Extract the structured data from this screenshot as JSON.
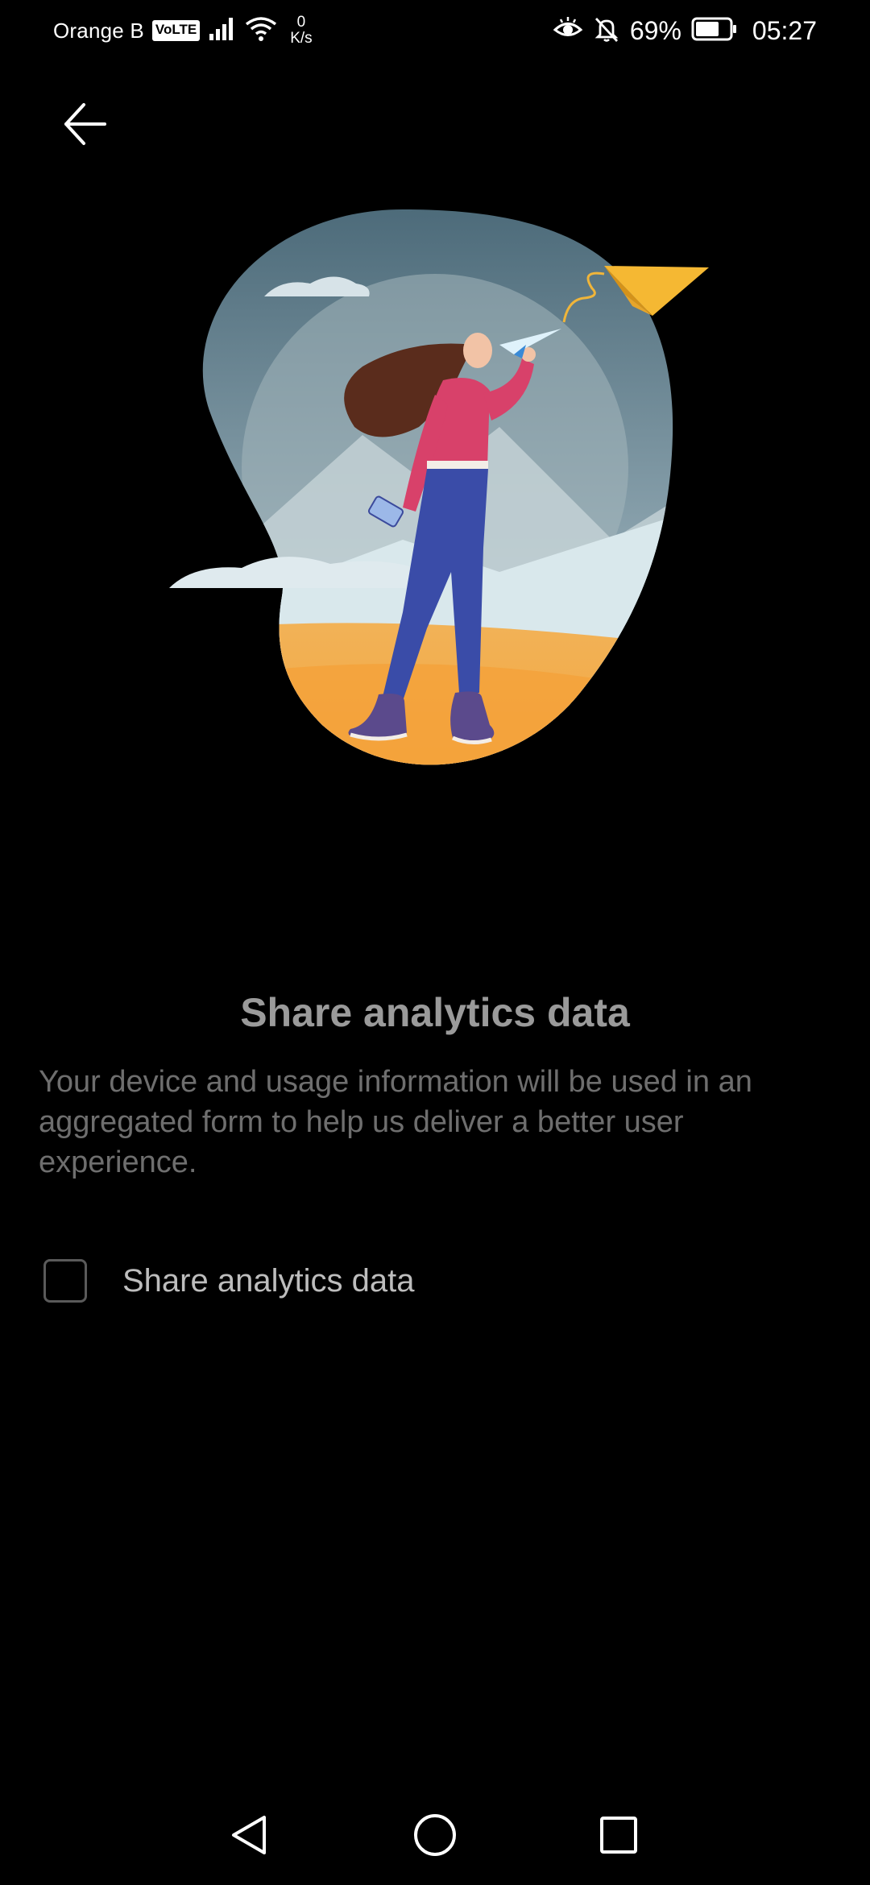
{
  "status_bar": {
    "carrier": "Orange B",
    "volte": "VoLTE",
    "net_speed_value": "0",
    "net_speed_unit": "K/s",
    "battery_percent": "69%",
    "battery_level": 0.69,
    "time": "05:27",
    "icons": [
      "signal-icon",
      "wifi-icon",
      "eye-comfort-icon",
      "alarm-muted-icon",
      "battery-icon"
    ]
  },
  "header": {
    "back_icon": "arrow-left-icon"
  },
  "main": {
    "title": "Share analytics data",
    "description": "Your device and usage information will be used in an aggregated form to help us deliver a better user experience.",
    "checkbox": {
      "label": "Share analytics data",
      "checked": false
    }
  },
  "nav_bar": {
    "icons": [
      "nav-back-icon",
      "nav-home-icon",
      "nav-recents-icon"
    ]
  },
  "colors": {
    "background": "#000000",
    "title": "#9a9a9a",
    "description": "#6e6e6e",
    "checkbox_border": "#5a5a5a"
  }
}
